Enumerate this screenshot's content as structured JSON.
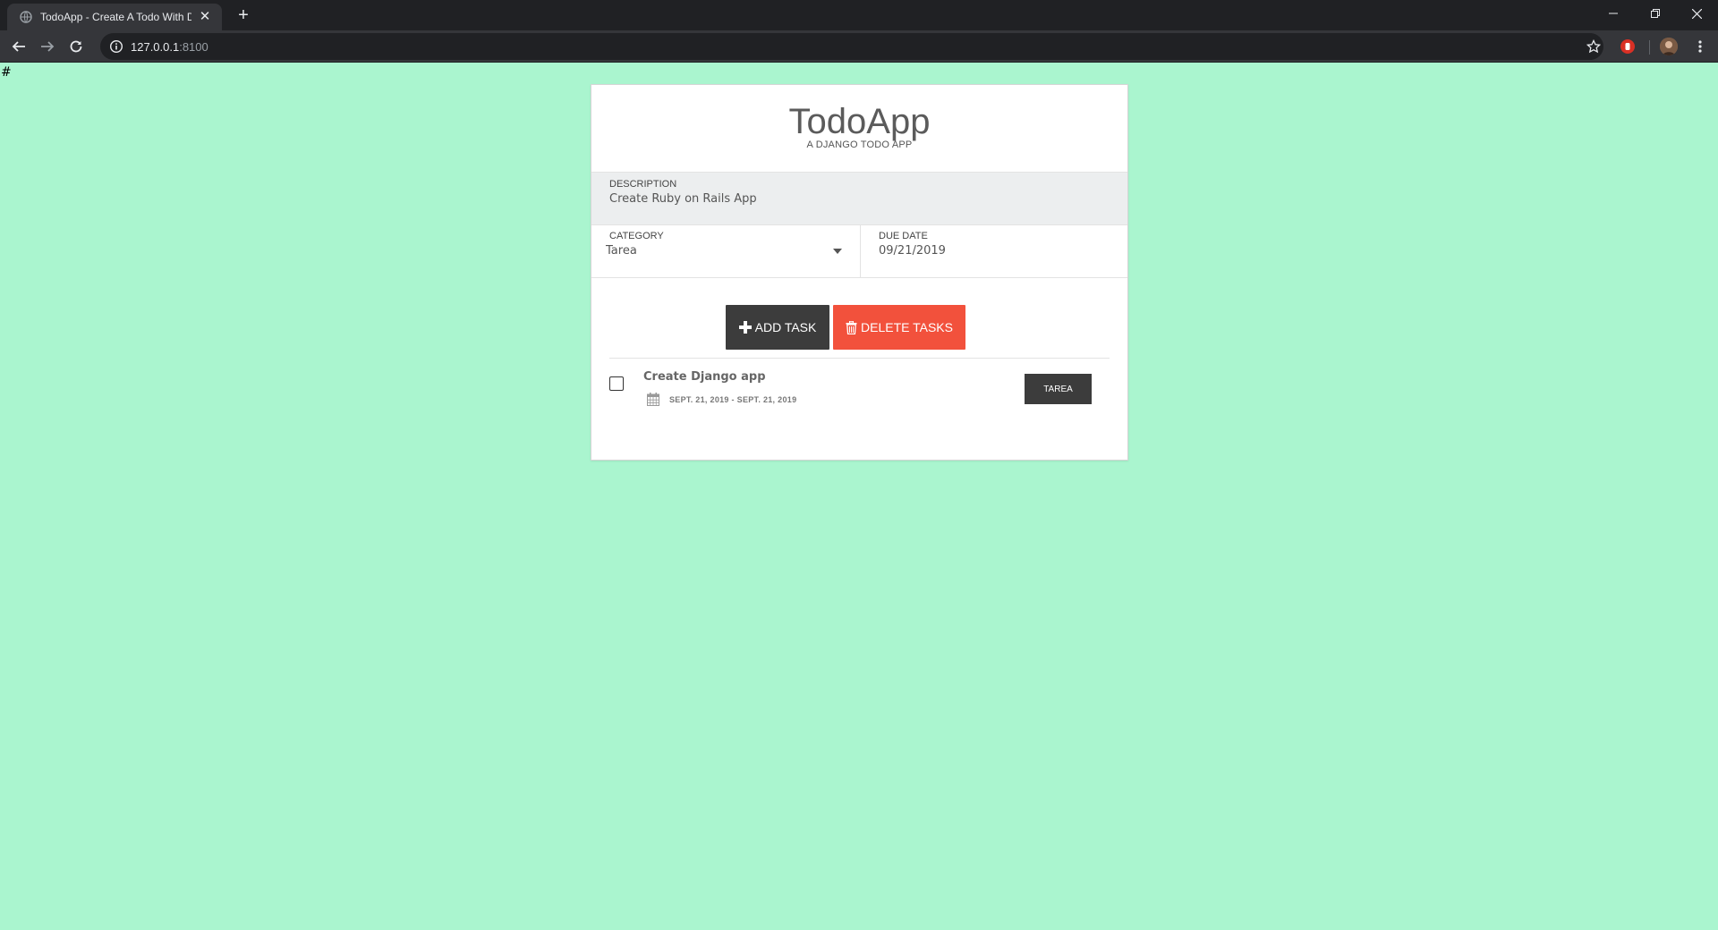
{
  "browser": {
    "tab_title": "TodoApp - Create A Todo With Django",
    "url_host": "127.0.0.1",
    "url_port": ":8100"
  },
  "page": {
    "hash_text": "#"
  },
  "header": {
    "title": "TodoApp",
    "subtitle": "A DJANGO TODO APP"
  },
  "form": {
    "description_label": "DESCRIPTION",
    "description_value": "Create Ruby on Rails App",
    "category_label": "CATEGORY",
    "category_value": "Tarea",
    "due_label": "DUE DATE",
    "due_value": "09/21/2019"
  },
  "actions": {
    "add_label": "ADD TASK",
    "delete_label": "DELETE TASKS"
  },
  "tasks": [
    {
      "title": "Create Django app",
      "dates": "SEPT. 21, 2019 - SEPT. 21, 2019",
      "category": "TAREA",
      "checked": false
    }
  ],
  "colors": {
    "page_bg": "#aaf5cf",
    "add_button": "#3c3c3c",
    "delete_button": "#f2513c"
  },
  "icons": {
    "add": "plus-icon",
    "delete": "trash-icon",
    "date": "calendar-icon"
  }
}
